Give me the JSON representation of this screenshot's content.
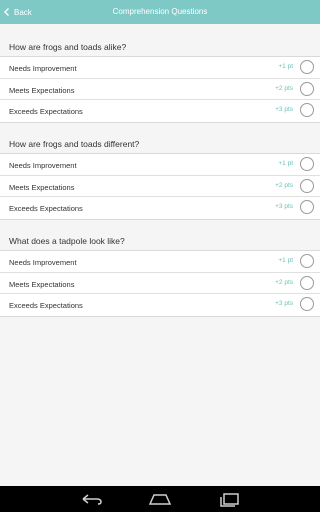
{
  "header": {
    "back_label": "Back",
    "title": "Comprehension Questions"
  },
  "sections": [
    {
      "question": "How are frogs and toads alike?",
      "options": [
        {
          "label": "Needs Improvement",
          "points": "+1 pt"
        },
        {
          "label": "Meets Expectations",
          "points": "+2 pts"
        },
        {
          "label": "Exceeds Expectations",
          "points": "+3 pts"
        }
      ]
    },
    {
      "question": "How are frogs and toads different?",
      "options": [
        {
          "label": "Needs Improvement",
          "points": "+1 pt"
        },
        {
          "label": "Meets Expectations",
          "points": "+2 pts"
        },
        {
          "label": "Exceeds Expectations",
          "points": "+3 pts"
        }
      ]
    },
    {
      "question": "What does a tadpole look like?",
      "options": [
        {
          "label": "Needs Improvement",
          "points": "+1 pt"
        },
        {
          "label": "Meets Expectations",
          "points": "+2 pts"
        },
        {
          "label": "Exceeds Expectations",
          "points": "+3 pts"
        }
      ]
    }
  ],
  "colors": {
    "header_bg": "#7ec8c6",
    "points_text": "#6dc1bb",
    "background": "#f5f5f5"
  },
  "icons": {
    "back": "chevron-left-icon",
    "nav_back": "back-arrow-icon",
    "nav_home": "home-icon",
    "nav_recents": "recents-icon"
  }
}
